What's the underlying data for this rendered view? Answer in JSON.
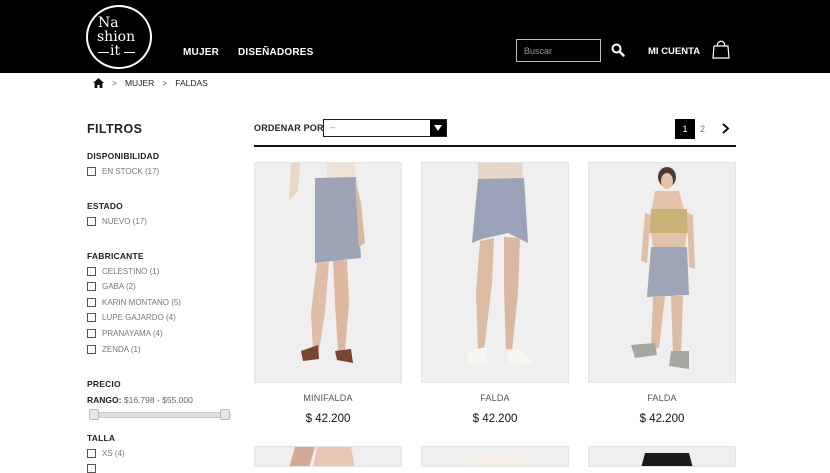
{
  "header": {
    "logo": {
      "line1": "Na",
      "line2": "shion",
      "line3": "it"
    },
    "nav": [
      {
        "label": "MUJER"
      },
      {
        "label": "DISEÑADORES"
      }
    ],
    "search": {
      "placeholder": "Buscar",
      "value": ""
    },
    "account_label": "MI CUENTA"
  },
  "breadcrumb": [
    "MUJER",
    "FALDAS"
  ],
  "filters": {
    "title": "FILTROS",
    "groups": [
      {
        "title": "DISPONIBILIDAD",
        "options": [
          "EN STOCK (17)"
        ]
      },
      {
        "title": "ESTADO",
        "options": [
          "NUEVO (17)"
        ]
      },
      {
        "title": "FABRICANTE",
        "options": [
          "CELESTINO (1)",
          "GABA (2)",
          "KARIN MONTANO (5)",
          "LUPE GAJARDO (4)",
          "PRANAYAMA (4)",
          "ZENDA (1)"
        ]
      },
      {
        "title": "TALLA",
        "options": [
          "XS (4)"
        ]
      }
    ],
    "price": {
      "title": "PRECIO",
      "range_label": "RANGO:",
      "range_value": "$16.798 - $55.000",
      "min_fraction": 0.0,
      "max_fraction": 1.0
    }
  },
  "toolbar": {
    "sort_label": "ORDENAR POR",
    "sort_value": "--"
  },
  "pagination": {
    "current": "1",
    "next_page": "2"
  },
  "products": [
    {
      "name": "MINIFALDA",
      "price": "$ 42.200"
    },
    {
      "name": "FALDA",
      "price": "$ 42.200"
    },
    {
      "name": "FALDA",
      "price": "$ 42.200"
    }
  ],
  "colors": {
    "header_bg": "#000000",
    "accent": "#000000",
    "text_muted": "#777777"
  }
}
